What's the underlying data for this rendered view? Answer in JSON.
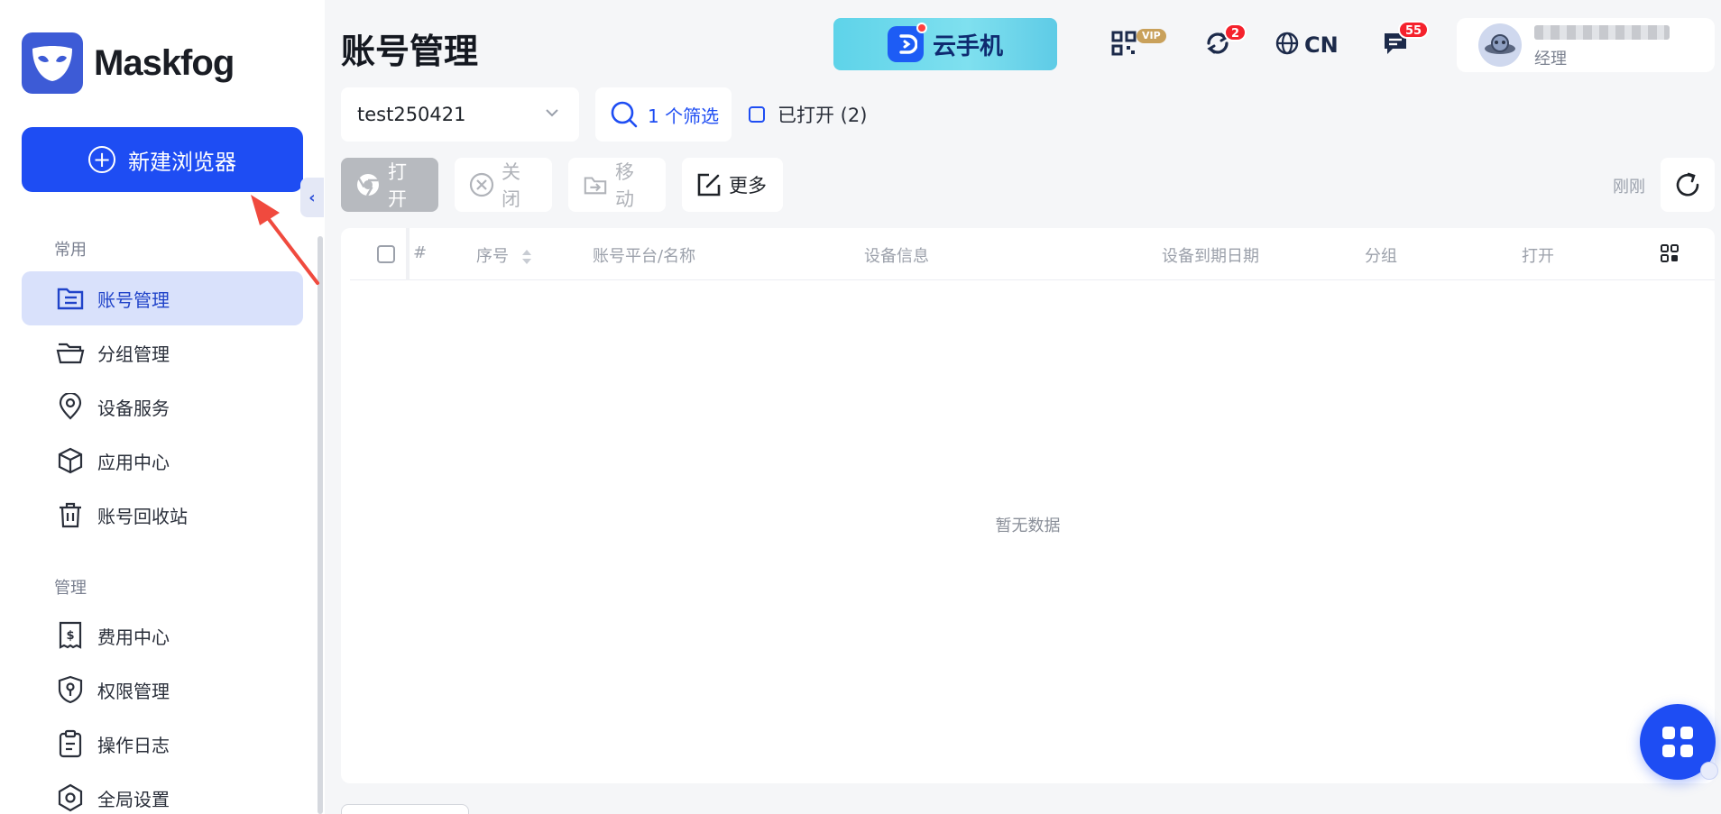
{
  "app": {
    "brand": "Maskfog",
    "page_title": "账号管理"
  },
  "sidebar": {
    "new_button_label": "新建浏览器",
    "section_common": "常用",
    "section_manage": "管理",
    "common_items": [
      {
        "label": "账号管理",
        "icon": "account-list-icon",
        "active": true
      },
      {
        "label": "分组管理",
        "icon": "folder-icon",
        "active": false
      },
      {
        "label": "设备服务",
        "icon": "location-pin-icon",
        "active": false
      },
      {
        "label": "应用中心",
        "icon": "cube-icon",
        "active": false
      },
      {
        "label": "账号回收站",
        "icon": "trash-icon",
        "active": false
      }
    ],
    "manage_items": [
      {
        "label": "费用中心",
        "icon": "receipt-icon"
      },
      {
        "label": "权限管理",
        "icon": "shield-key-icon"
      },
      {
        "label": "操作日志",
        "icon": "clipboard-icon"
      },
      {
        "label": "全局设置",
        "icon": "hex-settings-icon"
      }
    ]
  },
  "header": {
    "cloud_phone_label": "云手机",
    "vip_badge": "VIP",
    "sync_badge": "2",
    "language": "CN",
    "messages_badge": "55",
    "user_role": "经理"
  },
  "filters": {
    "group_value": "test250421",
    "filter_label": "1 个筛选",
    "opened_label": "已打开 (2)"
  },
  "actions": {
    "open": "打开",
    "close": "关闭",
    "move": "移动",
    "more": "更多",
    "refresh_time": "刚刚"
  },
  "table": {
    "columns": [
      "#",
      "序号",
      "账号平台/名称",
      "设备信息",
      "设备到期日期",
      "分组",
      "打开"
    ],
    "empty_text": "暂无数据"
  },
  "colors": {
    "primary": "#1e4df3",
    "sidebar_active_bg": "#d9e1fb",
    "badge_red": "#f5222d",
    "annotation_arrow": "#f04a3e"
  }
}
